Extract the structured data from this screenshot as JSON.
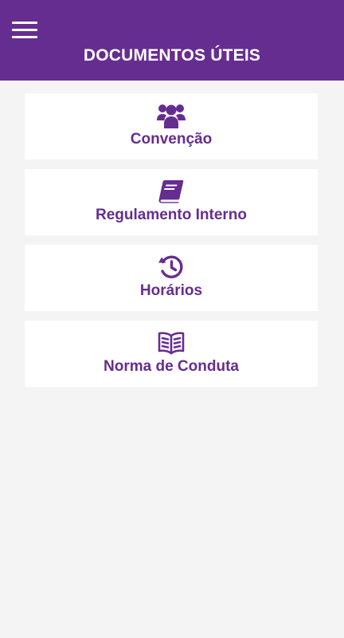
{
  "header": {
    "title": "DOCUMENTOS ÚTEIS",
    "menu_icon": "hamburger-menu-icon",
    "background_color": "#662d91",
    "text_color": "#ffffff"
  },
  "documents": [
    {
      "label": "Convenção",
      "icon": "users-group-icon"
    },
    {
      "label": "Regulamento Interno",
      "icon": "book-icon"
    },
    {
      "label": "Horários",
      "icon": "history-clock-icon"
    },
    {
      "label": "Norma de Conduta",
      "icon": "open-book-icon"
    }
  ],
  "colors": {
    "accent": "#662d91",
    "page_background": "#f4f4f4",
    "card_background": "#ffffff"
  }
}
